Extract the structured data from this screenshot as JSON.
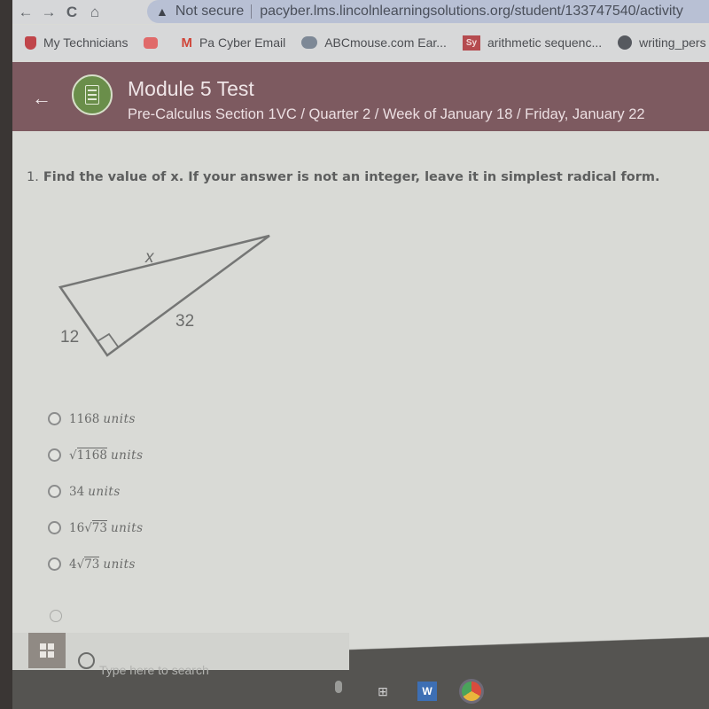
{
  "browser": {
    "nav": {
      "back": "←",
      "forward": "→",
      "reload": "C",
      "home": "⌂"
    },
    "security_label": "Not secure",
    "url": "pacyber.lms.lincolnlearningsolutions.org/student/133747540/activity",
    "bookmarks": [
      {
        "label": "My Technicians",
        "icon": "shield-icon"
      },
      {
        "label": "",
        "icon": "youtube-icon"
      },
      {
        "label": "Pa Cyber Email",
        "icon": "gmail-icon"
      },
      {
        "label": "ABCmouse.com Ear...",
        "icon": "abcmouse-icon"
      },
      {
        "label": "arithmetic sequenc...",
        "icon": "sy-icon",
        "icon_text": "Sy"
      },
      {
        "label": "writing_pers",
        "icon": "globe-icon"
      }
    ]
  },
  "header": {
    "title": "Module 5 Test",
    "breadcrumb": "Pre-Calculus Section 1VC / Quarter 2 / Week of January 18 / Friday, January 22",
    "colors": {
      "header_bg": "#7d5a60",
      "icon_bg": "#6a8e4a"
    }
  },
  "question": {
    "number": "1.",
    "text": "Find the value of x.  If your answer is not an integer, leave it in simplest radical form.",
    "diagram": {
      "type": "right-triangle",
      "labels": {
        "hypotenuse": "x",
        "leg_short": "12",
        "leg_long": "32"
      },
      "right_angle_marker": true
    },
    "options": [
      {
        "prefix": "1168",
        "radicand": "",
        "suffix": "units"
      },
      {
        "prefix": "",
        "radicand": "1168",
        "suffix": "units"
      },
      {
        "prefix": "34",
        "radicand": "",
        "suffix": "units"
      },
      {
        "prefix": "16",
        "radicand": "73",
        "suffix": "units"
      },
      {
        "prefix": "4",
        "radicand": "73",
        "suffix": "units"
      }
    ],
    "selected": null
  },
  "taskbar": {
    "search_placeholder": "Type here to search",
    "apps": [
      "task-view-icon",
      "word-icon",
      "chrome-icon"
    ]
  }
}
